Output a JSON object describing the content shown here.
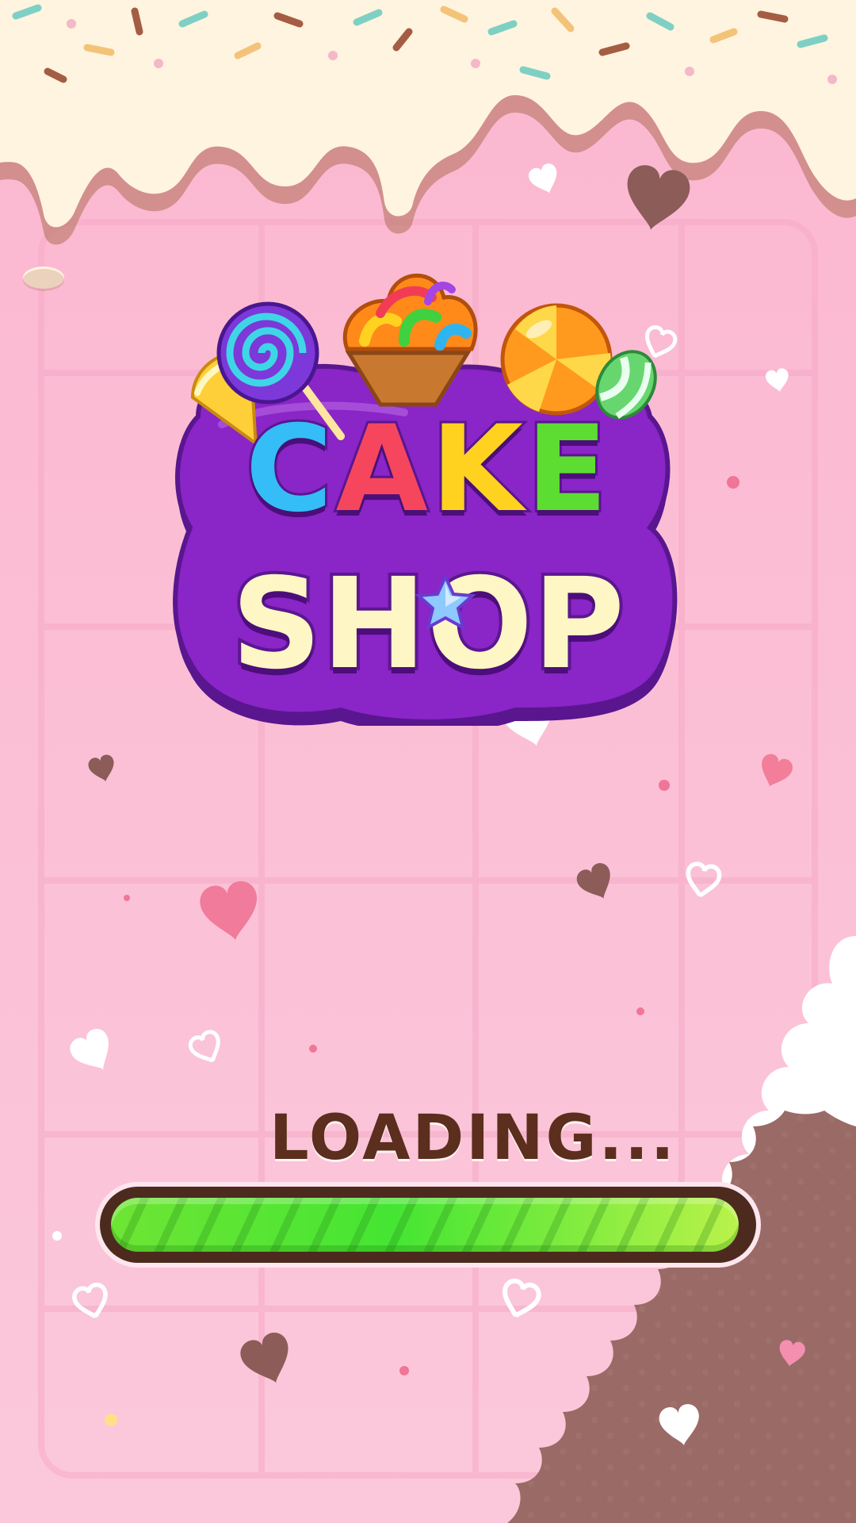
{
  "game": {
    "logo": {
      "line1": [
        "C",
        "A",
        "K",
        "E"
      ],
      "line2": "SHOP",
      "letter_colors": [
        "#34bdf6",
        "#f5465e",
        "#ffd21f",
        "#5ddc31"
      ]
    },
    "loading": {
      "label": "LOADING...",
      "progress": 0.99
    }
  },
  "colors": {
    "background": "#fcc3d9",
    "frosting": "#fff4df",
    "chocolate": "#9a6a66",
    "logo_purple": "#8a25c7",
    "progress_track": "#4c2b1e"
  },
  "icons": [
    "swirl-lollipop-icon",
    "rainbow-cupcake-icon",
    "orange-candy-icon",
    "candy-corn-icon",
    "mint-candy-icon",
    "heart-icon",
    "star-gem-icon"
  ]
}
